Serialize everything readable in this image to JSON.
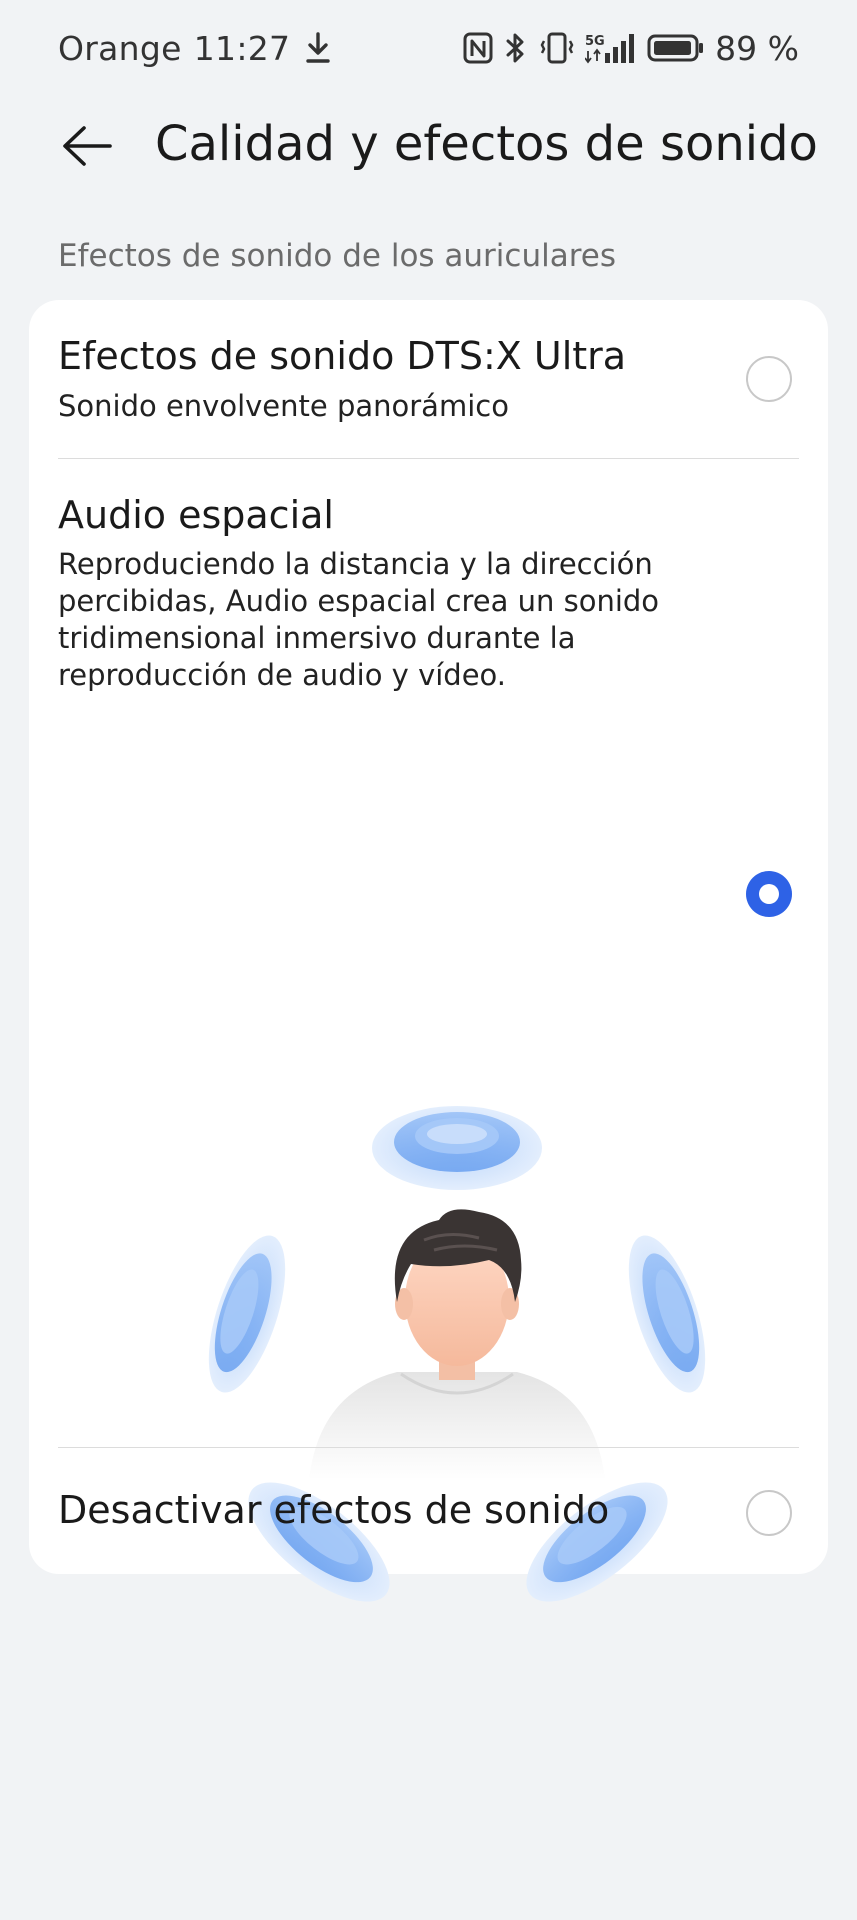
{
  "status_bar": {
    "carrier": "Orange",
    "time": "11:27",
    "battery": "89 %",
    "icons": [
      "download-icon",
      "nfc-icon",
      "bluetooth-icon",
      "vibrate-icon",
      "5g-signal-icon",
      "battery-icon"
    ]
  },
  "app_bar": {
    "title": "Calidad y efectos de sonido",
    "back_icon": "arrow-left-icon"
  },
  "section": {
    "header": "Efectos de sonido de los auriculares"
  },
  "options": [
    {
      "title": "Efectos de sonido DTS:X Ultra",
      "subtitle": "Sonido envolvente panorámico",
      "selected": false
    },
    {
      "title": "Audio espacial",
      "subtitle_lines": [
        "Reproduciendo la distancia y la dirección",
        "percibidas, Audio espacial crea un sonido",
        "tridimensional inmersivo durante la",
        "reproducción de audio y vídeo."
      ],
      "selected": true
    },
    {
      "title": "Desactivar efectos de sonido",
      "selected": false
    }
  ],
  "colors": {
    "accent": "#2e62e6",
    "background": "#f1f3f5",
    "card": "#ffffff",
    "sound_wave": "#6fa6f2"
  }
}
